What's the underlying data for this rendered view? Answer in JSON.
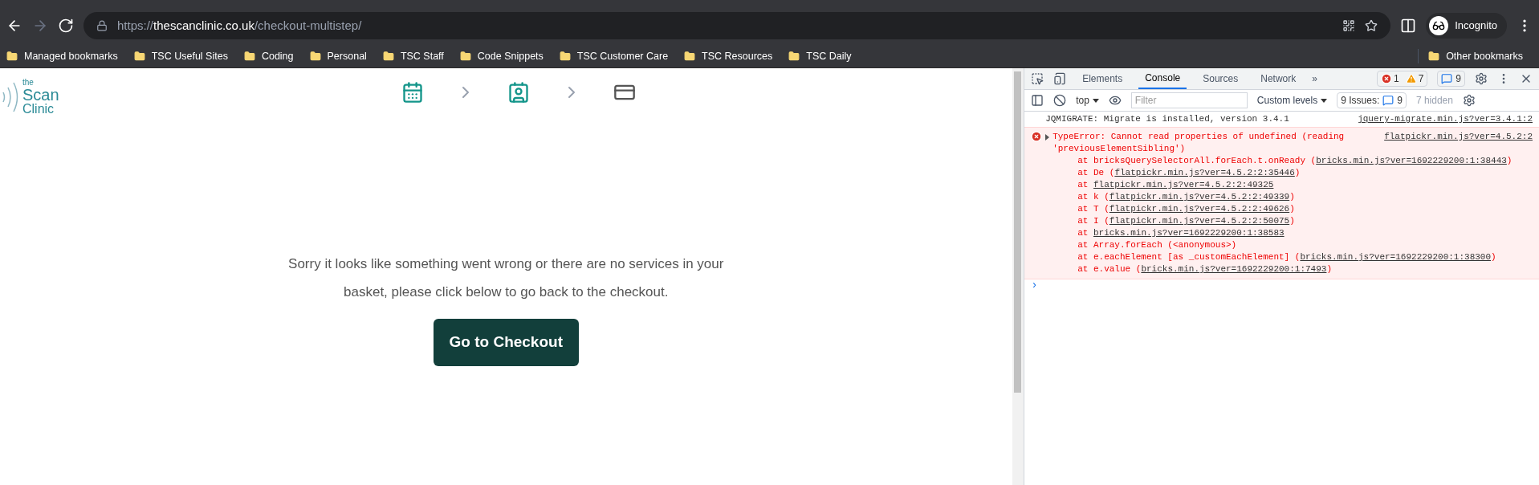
{
  "browser": {
    "url_host": "thescanclinic.co.uk",
    "url_scheme": "https://",
    "url_path": "/checkout-multistep/",
    "profile": "Incognito"
  },
  "bookmarks": [
    "Managed bookmarks",
    "TSC Useful Sites",
    "Coding",
    "Personal",
    "TSC Staff",
    "Code Snippets",
    "TSC Customer Care",
    "TSC Resources",
    "TSC Daily"
  ],
  "other_bookmarks": "Other bookmarks",
  "page": {
    "logo": {
      "small": "the",
      "line1": "Scan",
      "line2": "Clinic"
    },
    "steps": [
      {
        "kind": "calendar",
        "active": true
      },
      {
        "kind": "contact",
        "active": true
      },
      {
        "kind": "card",
        "active": false
      }
    ],
    "message": "Sorry it looks like something went wrong or there are no services in your basket, please click below to go back to the checkout.",
    "button": "Go to Checkout"
  },
  "devtools": {
    "tabs": [
      {
        "label": "Elements",
        "selected": false
      },
      {
        "label": "Console",
        "selected": true
      },
      {
        "label": "Sources",
        "selected": false
      },
      {
        "label": "Network",
        "selected": false
      }
    ],
    "more": "»",
    "errors": "1",
    "warnings": "7",
    "infos": "9",
    "context": "top",
    "filter_placeholder": "Filter",
    "levels": "Custom levels",
    "issues_label": "9 Issues:",
    "issues_count": "9",
    "hidden": "7 hidden",
    "messages": [
      {
        "kind": "log",
        "text": "JQMIGRATE: Migrate is installed, version 3.4.1",
        "source": "jquery-migrate.min.js?ver=3.4.1:2"
      },
      {
        "kind": "error",
        "text": "TypeError: Cannot read properties of undefined (reading 'previousElementSibling')",
        "source": "flatpickr.min.js?ver=4.5.2:2",
        "stack": [
          {
            "pre": "at bricksQuerySelectorAll.forEach.t.onReady (",
            "link": "bricks.min.js?ver=1692229200:1:38443",
            "post": ")"
          },
          {
            "pre": "at De (",
            "link": "flatpickr.min.js?ver=4.5.2:2:35446",
            "post": ")"
          },
          {
            "pre": "at ",
            "link": "flatpickr.min.js?ver=4.5.2:2:49325"
          },
          {
            "pre": "at k (",
            "link": "flatpickr.min.js?ver=4.5.2:2:49339",
            "post": ")"
          },
          {
            "pre": "at T (",
            "link": "flatpickr.min.js?ver=4.5.2:2:49626",
            "post": ")"
          },
          {
            "pre": "at I (",
            "link": "flatpickr.min.js?ver=4.5.2:2:50075",
            "post": ")"
          },
          {
            "pre": "at ",
            "link": "bricks.min.js?ver=1692229200:1:38583"
          },
          {
            "pre": "at Array.forEach (<anonymous>)"
          },
          {
            "pre": "at e.eachElement [as _customEachElement] (",
            "link": "bricks.min.js?ver=1692229200:1:38300",
            "post": ")"
          },
          {
            "pre": "at e.value (",
            "link": "bricks.min.js?ver=1692229200:1:7493",
            "post": ")"
          }
        ]
      }
    ],
    "prompt": "›"
  }
}
